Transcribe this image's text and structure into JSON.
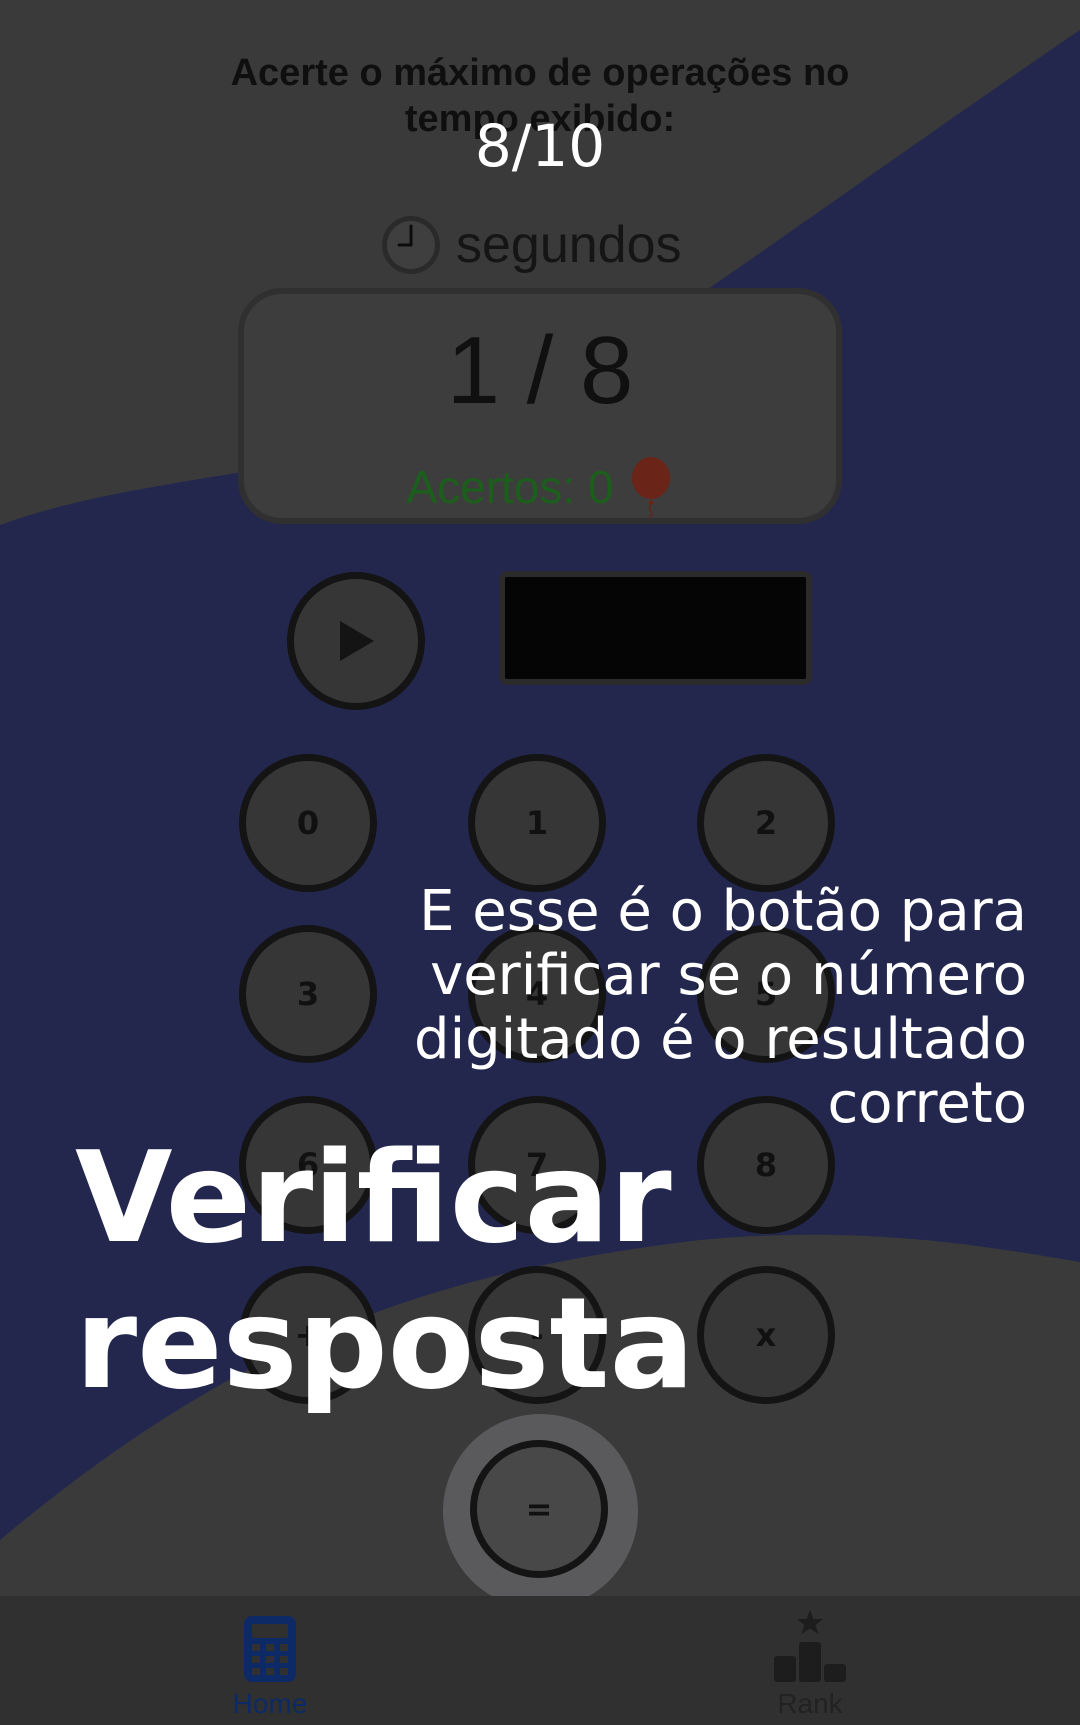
{
  "header": {
    "instructions": "Acerte o máximo de operações no tempo exibido:",
    "timer_label": "segundos"
  },
  "score_card": {
    "operation_progress": "1 / 8",
    "hits_label": "Acertos: 0"
  },
  "keypad": {
    "keys": [
      "0",
      "1",
      "2",
      "3",
      "4",
      "5",
      "6",
      "7",
      "8",
      "+",
      "-",
      "x"
    ],
    "equals_label": "="
  },
  "tutorial": {
    "step_counter": "8/10",
    "title": "Verificar resposta",
    "description": "E esse é o botão para verificar se o número digitado é o resultado correto"
  },
  "bottom_nav": {
    "home_label": "Home",
    "rank_label": "Rank"
  },
  "colors": {
    "dim_overlay": "#3a3a3a",
    "wave": "#23274e",
    "hits_text": "#1c5e1c",
    "nav_active": "#0d2a66"
  },
  "icons": {
    "play": "play-icon",
    "clock": "clock-icon",
    "balloon": "balloon-icon",
    "home": "calculator-icon",
    "rank": "podium-star-icon"
  }
}
